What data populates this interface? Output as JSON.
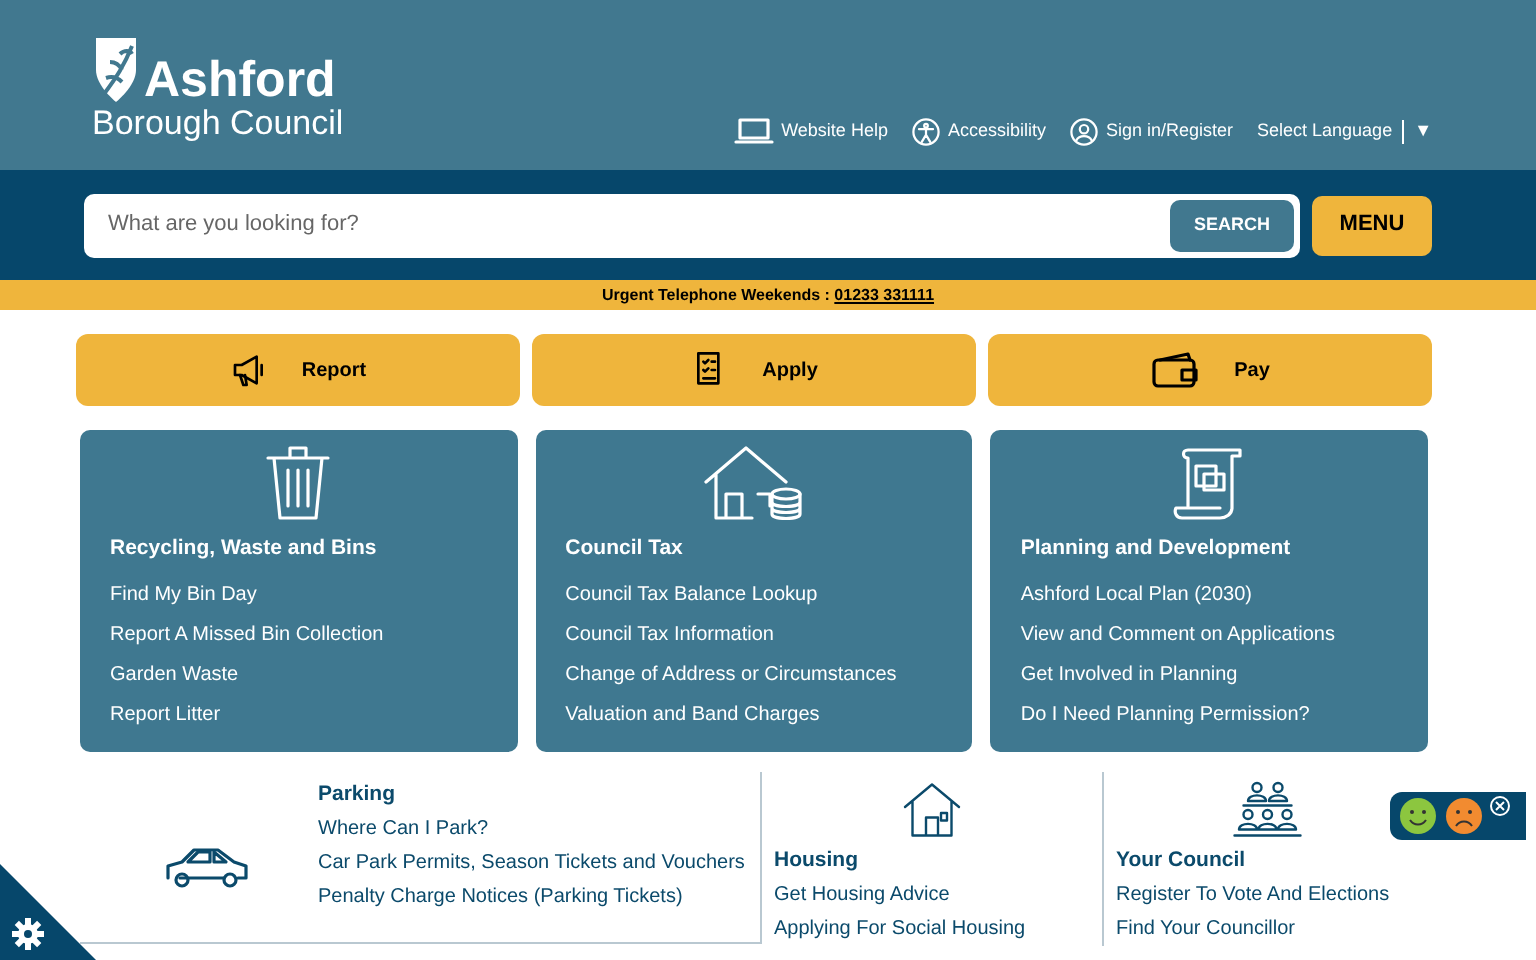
{
  "header": {
    "logo": {
      "line1": "Ashford",
      "line2": "Borough Council"
    },
    "links": [
      {
        "label": "Website Help",
        "kind": "laptop"
      },
      {
        "label": "Accessibility",
        "kind": "person"
      },
      {
        "label": "Sign in/Register",
        "kind": "user"
      }
    ],
    "language": {
      "label": "Select Language",
      "caret": "▼"
    }
  },
  "search": {
    "placeholder": "What are you looking for?",
    "button": "SEARCH",
    "menu": "MENU"
  },
  "alert": {
    "label": "Urgent Telephone Weekends :",
    "phone": "01233 331111"
  },
  "actions": [
    {
      "label": "Report",
      "kind": "megaphone"
    },
    {
      "label": "Apply",
      "kind": "form"
    },
    {
      "label": "Pay",
      "kind": "wallet"
    }
  ],
  "cards": [
    {
      "title": "Recycling, Waste and Bins",
      "kind": "bin",
      "links": [
        "Find My Bin Day",
        "Report A Missed Bin Collection",
        "Garden Waste",
        "Report Litter"
      ]
    },
    {
      "title": "Council Tax",
      "kind": "coins",
      "links": [
        "Council Tax Balance Lookup",
        "Council Tax Information",
        "Change of Address or Circumstances",
        "Valuation and Band Charges"
      ]
    },
    {
      "title": "Planning and Development",
      "kind": "scroll",
      "links": [
        "Ashford Local Plan (2030)",
        "View and Comment on Applications",
        "Get Involved in Planning",
        "Do I Need Planning Permission?"
      ]
    }
  ],
  "sections": [
    {
      "title": "Parking",
      "kind": "car",
      "links": [
        "Where Can I Park?",
        "Car Park Permits, Season Tickets and Vouchers",
        "Penalty Charge Notices (Parking Tickets)"
      ]
    },
    {
      "title": "Housing",
      "kind": "house",
      "links": [
        "Get Housing Advice",
        "Applying For Social Housing"
      ]
    },
    {
      "title": "Your Council",
      "kind": "people",
      "links": [
        "Register To Vote And Elections",
        "Find Your Councillor"
      ]
    }
  ]
}
